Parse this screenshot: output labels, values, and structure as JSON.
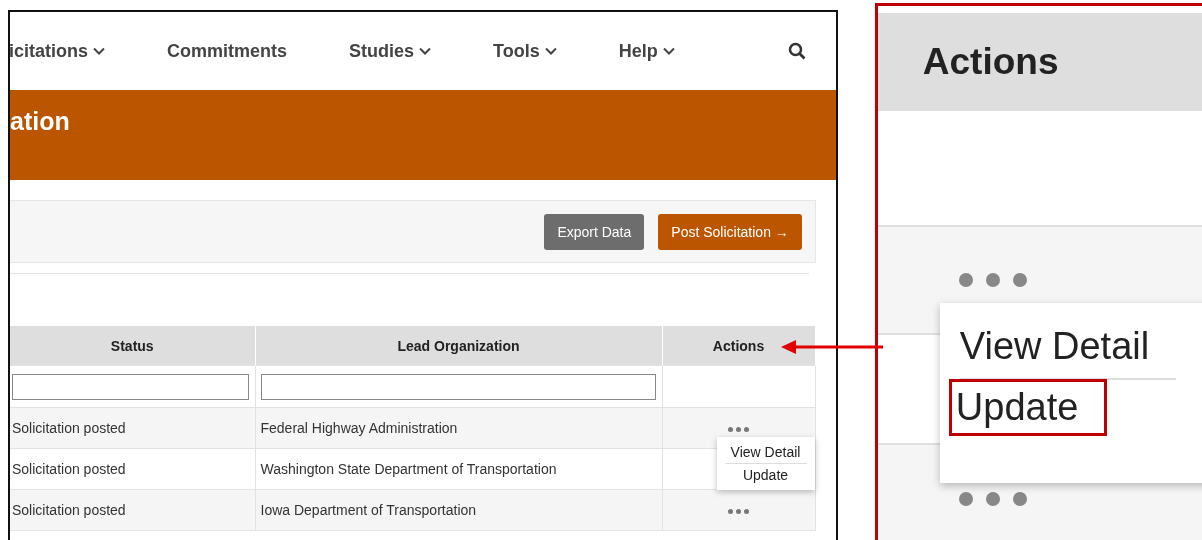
{
  "nav": {
    "items": [
      {
        "label": "icitations",
        "dropdown": true
      },
      {
        "label": "Commitments",
        "dropdown": false
      },
      {
        "label": "Studies",
        "dropdown": true
      },
      {
        "label": "Tools",
        "dropdown": true
      },
      {
        "label": "Help",
        "dropdown": true
      }
    ]
  },
  "banner": {
    "title": "ation"
  },
  "toolbar": {
    "buttons": [
      {
        "label": "Export Data",
        "kind": "secondary"
      },
      {
        "label": "Post Solicitation →",
        "kind": "primary"
      }
    ]
  },
  "table": {
    "columns": [
      {
        "label": "Status",
        "filter": true
      },
      {
        "label": "Lead Organization",
        "filter": true
      },
      {
        "label": "Actions",
        "filter": false
      }
    ],
    "rows": [
      {
        "status": "Solicitation posted",
        "lead_organization": "Federal Highway Administration",
        "menu_open": true
      },
      {
        "status": "Solicitation posted",
        "lead_organization": "Washington State Department of Transportation",
        "menu_open": false
      },
      {
        "status": "Solicitation posted",
        "lead_organization": "Iowa Department of Transportation",
        "menu_open": false
      }
    ],
    "menu": {
      "items": [
        "View Detail",
        "Update"
      ]
    }
  },
  "callout": {
    "header": "Actions",
    "menu": [
      {
        "label": "View Detail",
        "highlighted": false
      },
      {
        "label": "Update",
        "highlighted": true
      }
    ]
  }
}
